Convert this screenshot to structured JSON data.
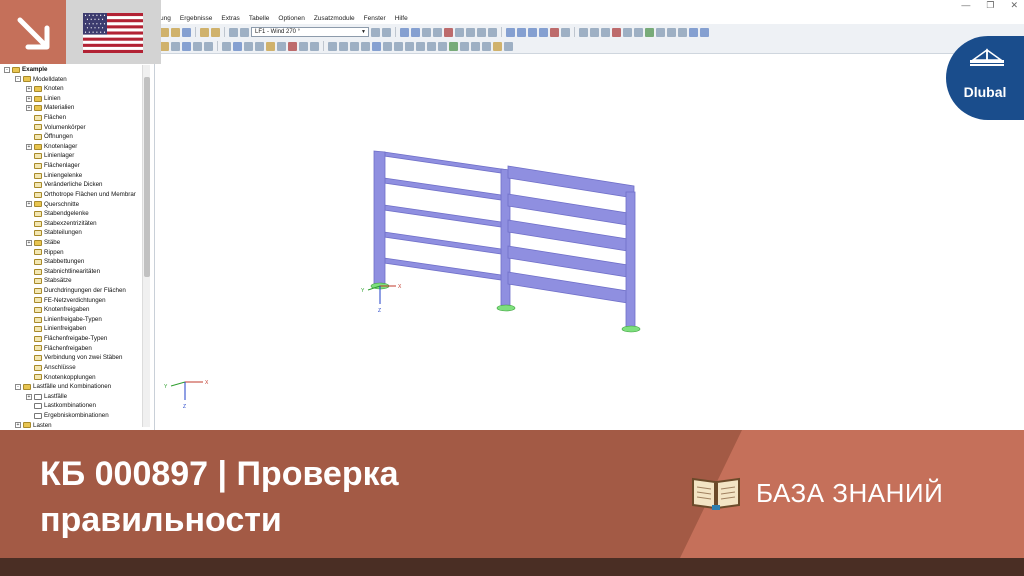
{
  "menu": {
    "items": [
      "ung",
      "Ergebnisse",
      "Extras",
      "Tabelle",
      "Optionen",
      "Zusatzmodule",
      "Fenster",
      "Hilfe"
    ]
  },
  "toolbar": {
    "load_case": "LF1 - Wind 270 °"
  },
  "navigator": {
    "rows": [
      {
        "label": "Example",
        "level": 0,
        "exp": "-",
        "icon": "folder"
      },
      {
        "label": "Modelldaten",
        "level": 1,
        "exp": "-",
        "icon": "folder"
      },
      {
        "label": "Knoten",
        "level": 2,
        "exp": "+",
        "icon": "folder"
      },
      {
        "label": "Linien",
        "level": 2,
        "exp": "+",
        "icon": "folder"
      },
      {
        "label": "Materialien",
        "level": 2,
        "exp": "+",
        "icon": "folder"
      },
      {
        "label": "Flächen",
        "level": 2,
        "exp": "",
        "icon": "file"
      },
      {
        "label": "Volumenkörper",
        "level": 2,
        "exp": "",
        "icon": "file"
      },
      {
        "label": "Öffnungen",
        "level": 2,
        "exp": "",
        "icon": "file"
      },
      {
        "label": "Knotenlager",
        "level": 2,
        "exp": "+",
        "icon": "folder"
      },
      {
        "label": "Linienlager",
        "level": 2,
        "exp": "",
        "icon": "file"
      },
      {
        "label": "Flächenlager",
        "level": 2,
        "exp": "",
        "icon": "file"
      },
      {
        "label": "Liniengelenke",
        "level": 2,
        "exp": "",
        "icon": "file"
      },
      {
        "label": "Veränderliche Dicken",
        "level": 2,
        "exp": "",
        "icon": "file"
      },
      {
        "label": "Orthotrope Flächen und Membrar",
        "level": 2,
        "exp": "",
        "icon": "file"
      },
      {
        "label": "Querschnitte",
        "level": 2,
        "exp": "+",
        "icon": "folder"
      },
      {
        "label": "Stabendgelenke",
        "level": 2,
        "exp": "",
        "icon": "file"
      },
      {
        "label": "Stabexzentrizitäten",
        "level": 2,
        "exp": "",
        "icon": "file"
      },
      {
        "label": "Stabteilungen",
        "level": 2,
        "exp": "",
        "icon": "file"
      },
      {
        "label": "Stäbe",
        "level": 2,
        "exp": "+",
        "icon": "folder"
      },
      {
        "label": "Rippen",
        "level": 2,
        "exp": "",
        "icon": "file"
      },
      {
        "label": "Stabbettungen",
        "level": 2,
        "exp": "",
        "icon": "file"
      },
      {
        "label": "Stabnichtlinearitäten",
        "level": 2,
        "exp": "",
        "icon": "file"
      },
      {
        "label": "Stabsätze",
        "level": 2,
        "exp": "",
        "icon": "file"
      },
      {
        "label": "Durchdringungen der Flächen",
        "level": 2,
        "exp": "",
        "icon": "file"
      },
      {
        "label": "FE-Netzverdichtungen",
        "level": 2,
        "exp": "",
        "icon": "file"
      },
      {
        "label": "Knotenfreigaben",
        "level": 2,
        "exp": "",
        "icon": "file"
      },
      {
        "label": "Linienfreigabe-Typen",
        "level": 2,
        "exp": "",
        "icon": "file"
      },
      {
        "label": "Linienfreigaben",
        "level": 2,
        "exp": "",
        "icon": "file"
      },
      {
        "label": "Flächenfreigabe-Typen",
        "level": 2,
        "exp": "",
        "icon": "file"
      },
      {
        "label": "Flächenfreigaben",
        "level": 2,
        "exp": "",
        "icon": "file"
      },
      {
        "label": "Verbindung von zwei Stäben",
        "level": 2,
        "exp": "",
        "icon": "file"
      },
      {
        "label": "Anschlüsse",
        "level": 2,
        "exp": "",
        "icon": "file"
      },
      {
        "label": "Knotenkopplungen",
        "level": 2,
        "exp": "",
        "icon": "file"
      },
      {
        "label": "Lastfälle und Kombinationen",
        "level": 1,
        "exp": "-",
        "icon": "folder"
      },
      {
        "label": "Lastfälle",
        "level": 2,
        "exp": "+",
        "icon": "load"
      },
      {
        "label": "Lastkombinationen",
        "level": 2,
        "exp": "",
        "icon": "load"
      },
      {
        "label": "Ergebniskombinationen",
        "level": 2,
        "exp": "",
        "icon": "load"
      },
      {
        "label": "Lasten",
        "level": 1,
        "exp": "+",
        "icon": "folder"
      }
    ]
  },
  "axes": {
    "x": "X",
    "y": "Y",
    "z": "Z"
  },
  "logo": {
    "text": "Dlubal"
  },
  "banner": {
    "title_line1": "КБ 000897 | Проверка",
    "title_line2": "правильности",
    "kb_label": "БАЗА ЗНАНИЙ"
  },
  "colors": {
    "accent": "#c5705a",
    "banner": "#a35a45",
    "footer": "#4a2e24",
    "logo": "#1a4d8c",
    "member": "#8f8fe0",
    "support": "#7ee07e"
  }
}
